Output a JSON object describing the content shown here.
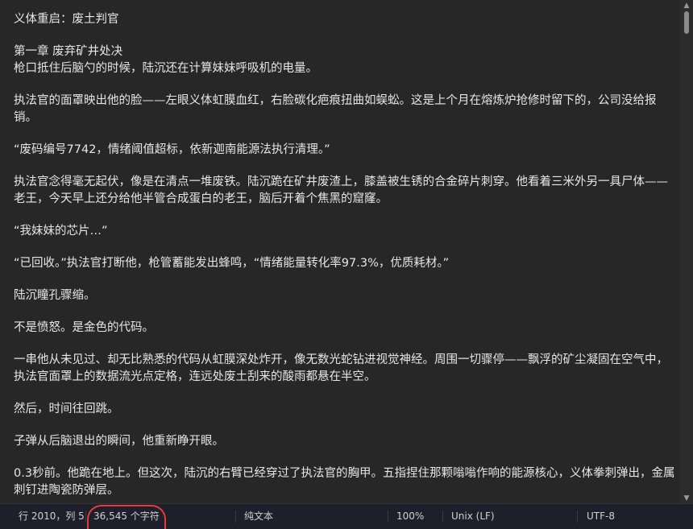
{
  "document": {
    "paragraphs": [
      "义体重启：废土判官",
      "第一章 废弃矿井处决\n枪口抵住后脑勺的时候，陆沉还在计算妹妹呼吸机的电量。",
      "执法官的面罩映出他的脸——左眼义体虹膜血红，右脸碳化疤痕扭曲如蜈蚣。这是上个月在熔炼炉抢修时留下的，公司没给报销。",
      "“废码编号7742，情绪阈值超标，依新迦南能源法执行清理。”",
      "执法官念得毫无起伏，像是在清点一堆废铁。陆沉跪在矿井废渣上，膝盖被生锈的合金碎片刺穿。他看着三米外另一具尸体——老王，今天早上还分给他半管合成蛋白的老王，脑后开着个焦黑的窟窿。",
      "“我妹妹的芯片…”",
      "“已回收。”执法官打断他，枪管蓄能发出蜂鸣，“情绪能量转化率97.3%，优质耗材。”",
      "陆沉瞳孔骤缩。",
      "不是愤怒。是金色的代码。",
      "一串他从未见过、却无比熟悉的代码从虹膜深处炸开，像无数光蛇钻进视觉神经。周围一切骤停——飘浮的矿尘凝固在空气中，执法官面罩上的数据流光点定格，连远处废土刮来的酸雨都悬在半空。",
      "然后，时间往回跳。",
      "子弹从后脑退出的瞬间，他重新睁开眼。",
      "0.3秒前。他跪在地上。但这次，陆沉的右臂已经穿过了执法官的胸甲。五指捏住那颗嗡嗡作响的能源核心，义体拳刺弹出，金属刺钉进陶瓷防弹层。"
    ]
  },
  "statusbar": {
    "position": "行 2010，列 5",
    "char_count": "36,545 个字符",
    "format": "纯文本",
    "zoom": "100%",
    "line_ending": "Unix (LF)",
    "encoding": "UTF-8"
  },
  "scrollbar": {
    "up_icon": "▲",
    "down_icon": "▼"
  },
  "colors": {
    "background": "#272727",
    "text": "#e6e6e6",
    "statusbar": "#1f1f2b",
    "annotation": "#e63b3b"
  }
}
